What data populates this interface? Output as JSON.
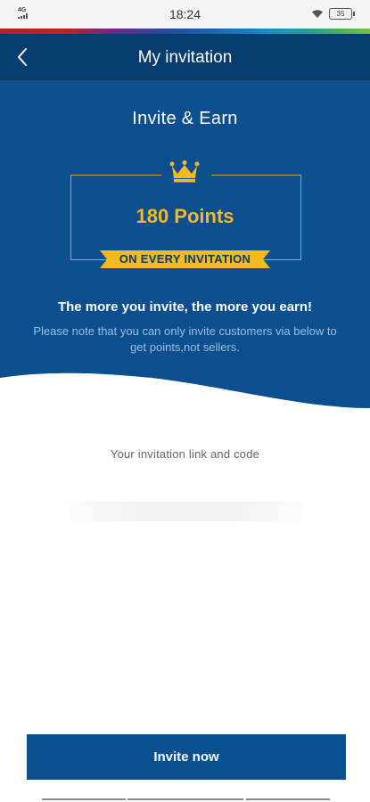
{
  "status": {
    "network": "4G",
    "time": "18:24",
    "battery": "35"
  },
  "nav": {
    "title": "My invitation"
  },
  "hero": {
    "title": "Invite & Earn",
    "points": "180 Points",
    "ribbon": "ON EVERY INVITATION",
    "tagline": "The more you invite, the more you earn!",
    "note": "Please note that you can only invite customers via below to get points,not sellers."
  },
  "invitation": {
    "label": "Your invitation link and code",
    "link": ""
  },
  "actions": {
    "invite_label": "Invite now"
  },
  "colors": {
    "nav_bg": "#063d6e",
    "hero_bg": "#0b4f8f",
    "gold": "#f5b921",
    "button_bg": "#0a4f8f"
  }
}
